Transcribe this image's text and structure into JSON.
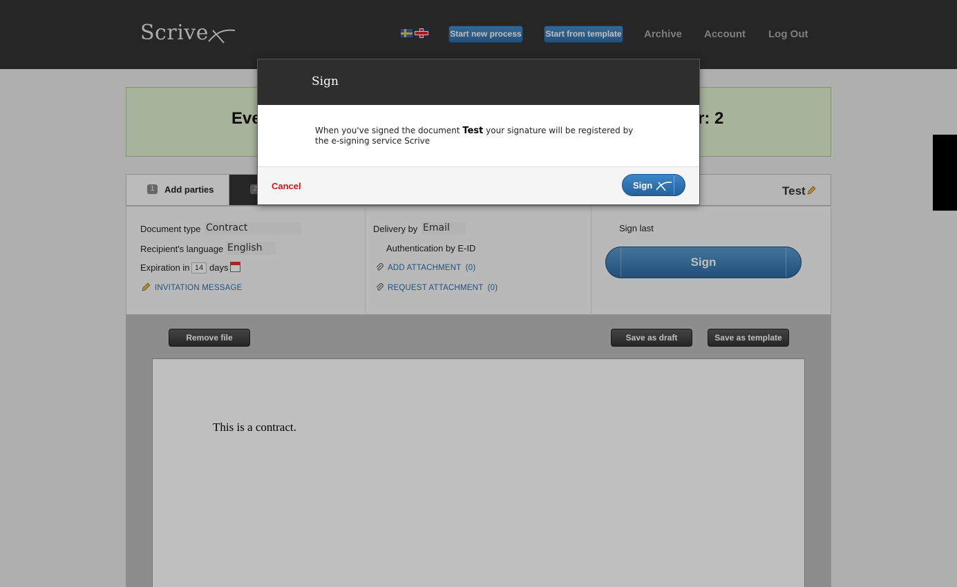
{
  "header": {
    "logo": "Scrive",
    "start_new_process": "Start new process",
    "start_from_template": "Start from template",
    "archive": "Archive",
    "account": "Account",
    "log_out": "Log Out"
  },
  "banner": {
    "text_left": "Eve",
    "text_right": "r: 2"
  },
  "tabs": {
    "step1_number": "1",
    "step1_label": "Add parties",
    "step2_number": "2",
    "document_name": "Test"
  },
  "settings": {
    "document_type_label": "Document type",
    "document_type_value": "Contract",
    "recipient_language_label": "Recipient's language",
    "recipient_language_value": "English",
    "expiration_prefix": "Expiration in",
    "expiration_days": "14",
    "expiration_suffix": "days",
    "invitation_message": "INVITATION MESSAGE",
    "delivery_label": "Delivery by",
    "delivery_value": "Email",
    "authentication": "Authentication by E-ID",
    "add_attachment": "ADD ATTACHMENT",
    "add_attachment_count": "(0)",
    "request_attachment": "REQUEST ATTACHMENT",
    "request_attachment_count": "(0)",
    "sign_last": "Sign last",
    "sign_button": "Sign"
  },
  "toolbar": {
    "remove_file": "Remove file",
    "save_as_draft": "Save as draft",
    "save_as_template": "Save as template"
  },
  "document": {
    "content": "This is a contract."
  },
  "modal": {
    "title": "Sign",
    "body_before": "When you've signed the document ",
    "body_doc_name": "Test",
    "body_after": " your signature will be registered by the e-signing service Scrive",
    "cancel": "Cancel",
    "sign": "Sign"
  },
  "colors": {
    "header_bg": "#333333",
    "accent_blue": "#2f6ca6",
    "banner_green": "#dfefcf",
    "cancel_red": "#cc1a1a"
  }
}
